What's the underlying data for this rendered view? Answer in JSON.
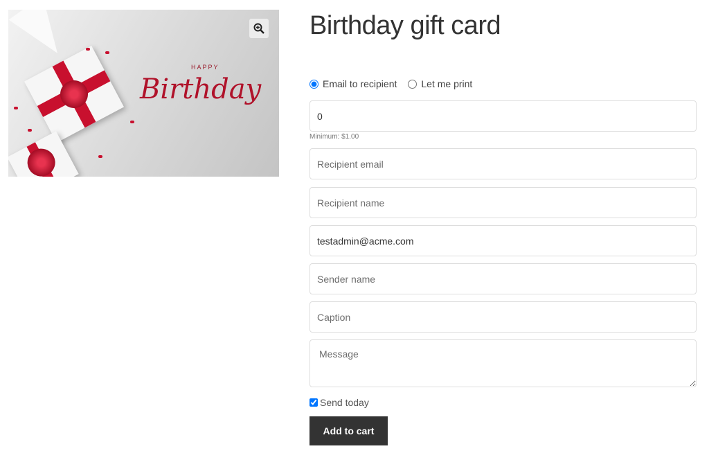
{
  "product": {
    "title": "Birthday gift card",
    "image": {
      "lettering_small": "HAPPY",
      "lettering_large": "Birthday",
      "zoom_icon": "magnifier-plus-icon"
    },
    "delivery_options": [
      {
        "label": "Email to recipient",
        "checked": true
      },
      {
        "label": "Let me print",
        "checked": false
      }
    ],
    "amount": {
      "value": "0",
      "hint": "Minimum: $1.00"
    },
    "fields": {
      "recipient_email": {
        "placeholder": "Recipient email",
        "value": ""
      },
      "recipient_name": {
        "placeholder": "Recipient name",
        "value": ""
      },
      "sender_email": {
        "value": "testadmin@acme.com"
      },
      "sender_name": {
        "placeholder": "Sender name",
        "value": ""
      },
      "caption": {
        "placeholder": "Caption",
        "value": ""
      },
      "message": {
        "placeholder": "Message",
        "value": ""
      }
    },
    "send_today": {
      "label": "Send today",
      "checked": true
    },
    "add_to_cart": "Add to cart",
    "colors": {
      "button": "#333333",
      "accent": "#1a73e8",
      "ribbon": "#c8102e"
    }
  }
}
